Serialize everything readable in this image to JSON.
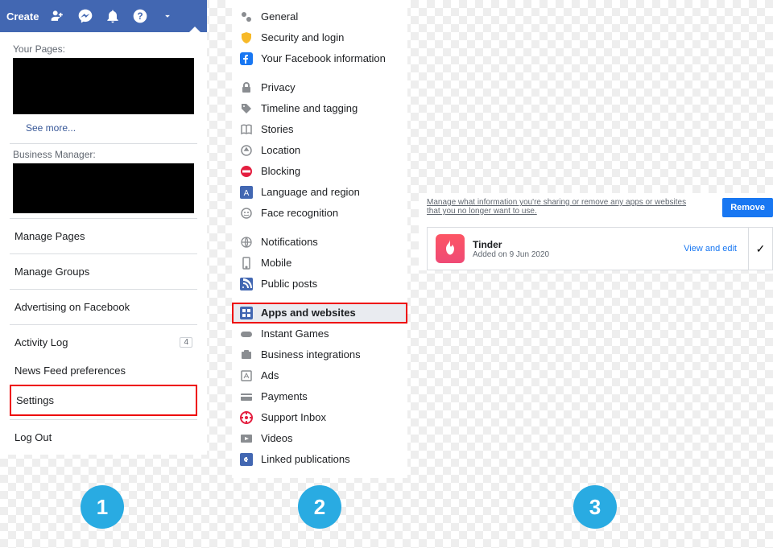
{
  "topbar": {
    "create": "Create"
  },
  "dropdown": {
    "your_pages": "Your Pages:",
    "see_more": "See more...",
    "business_manager": "Business Manager:",
    "items": [
      {
        "label": "Manage Pages"
      },
      {
        "label": "Manage Groups"
      },
      {
        "label": "Advertising on Facebook"
      },
      {
        "label": "Activity Log",
        "badge": "4"
      },
      {
        "label": "News Feed preferences"
      },
      {
        "label": "Settings",
        "highlight": true
      },
      {
        "label": "Log Out"
      }
    ]
  },
  "settings_nav": {
    "groups": [
      [
        {
          "label": "General",
          "icon": "gears"
        },
        {
          "label": "Security and login",
          "icon": "shield"
        },
        {
          "label": "Your Facebook information",
          "icon": "fb"
        }
      ],
      [
        {
          "label": "Privacy",
          "icon": "lock"
        },
        {
          "label": "Timeline and tagging",
          "icon": "tag"
        },
        {
          "label": "Stories",
          "icon": "book"
        },
        {
          "label": "Location",
          "icon": "location"
        },
        {
          "label": "Blocking",
          "icon": "block"
        },
        {
          "label": "Language and region",
          "icon": "globe-flag"
        },
        {
          "label": "Face recognition",
          "icon": "face"
        }
      ],
      [
        {
          "label": "Notifications",
          "icon": "globe"
        },
        {
          "label": "Mobile",
          "icon": "mobile"
        },
        {
          "label": "Public posts",
          "icon": "rss"
        }
      ],
      [
        {
          "label": "Apps and websites",
          "icon": "apps",
          "selected": true
        },
        {
          "label": "Instant Games",
          "icon": "games"
        },
        {
          "label": "Business integrations",
          "icon": "biz"
        },
        {
          "label": "Ads",
          "icon": "ads"
        },
        {
          "label": "Payments",
          "icon": "card"
        },
        {
          "label": "Support Inbox",
          "icon": "support"
        },
        {
          "label": "Videos",
          "icon": "video"
        },
        {
          "label": "Linked publications",
          "icon": "linked"
        }
      ]
    ]
  },
  "apps_panel": {
    "description": "Manage what information you're sharing or remove any apps or websites that you no longer want to use.",
    "remove": "Remove",
    "app": {
      "name": "Tinder",
      "added": "Added on 9 Jun 2020",
      "action": "View and edit"
    }
  },
  "steps": {
    "one": "1",
    "two": "2",
    "three": "3"
  }
}
